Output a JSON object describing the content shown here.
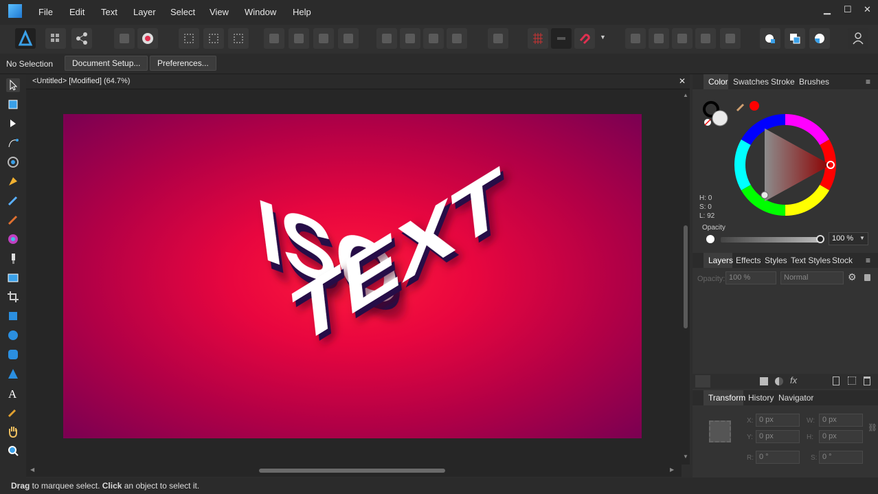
{
  "menu": {
    "items": [
      "File",
      "Edit",
      "Text",
      "Layer",
      "Select",
      "View",
      "Window",
      "Help"
    ]
  },
  "window_controls": {
    "minimize": "▁",
    "maximize": "☐",
    "close": "✕"
  },
  "context_bar": {
    "selection_label": "No Selection",
    "document_setup": "Document Setup...",
    "preferences": "Preferences..."
  },
  "document": {
    "tab_title": "<Untitled> [Modified] (64.7%)",
    "close": "✕"
  },
  "artwork": {
    "line1": "ISO",
    "line2": "TEXT",
    "colors": {
      "front": "#ffffff",
      "side": "#260a47",
      "bg_center": "#ff1a3c",
      "bg_edge": "#7a0052"
    }
  },
  "color_panel": {
    "tabs": [
      "Color",
      "Swatches",
      "Stroke",
      "Brushes"
    ],
    "h": "H: 0",
    "s": "S: 0",
    "l": "L: 92",
    "opacity_label": "Opacity",
    "opacity_value": "100 %",
    "accent": "#ff0000"
  },
  "layers_panel": {
    "tabs": [
      "Layers",
      "Effects",
      "Styles",
      "Text Styles",
      "Stock"
    ],
    "opacity_label": "Opacity:",
    "opacity_value": "100 %",
    "blend_mode": "Normal"
  },
  "transform_panel": {
    "tabs": [
      "Transform",
      "History",
      "Navigator"
    ],
    "x_label": "X:",
    "x_value": "0 px",
    "y_label": "Y:",
    "y_value": "0 px",
    "w_label": "W:",
    "w_value": "0 px",
    "h_label": "H:",
    "h_value": "0 px",
    "r_label": "R:",
    "r_value": "0 °",
    "s_label": "S:",
    "s_value": "0 °"
  },
  "status": {
    "drag": "Drag",
    "drag_rest": " to marquee select. ",
    "click": "Click",
    "click_rest": " an object to select it."
  }
}
